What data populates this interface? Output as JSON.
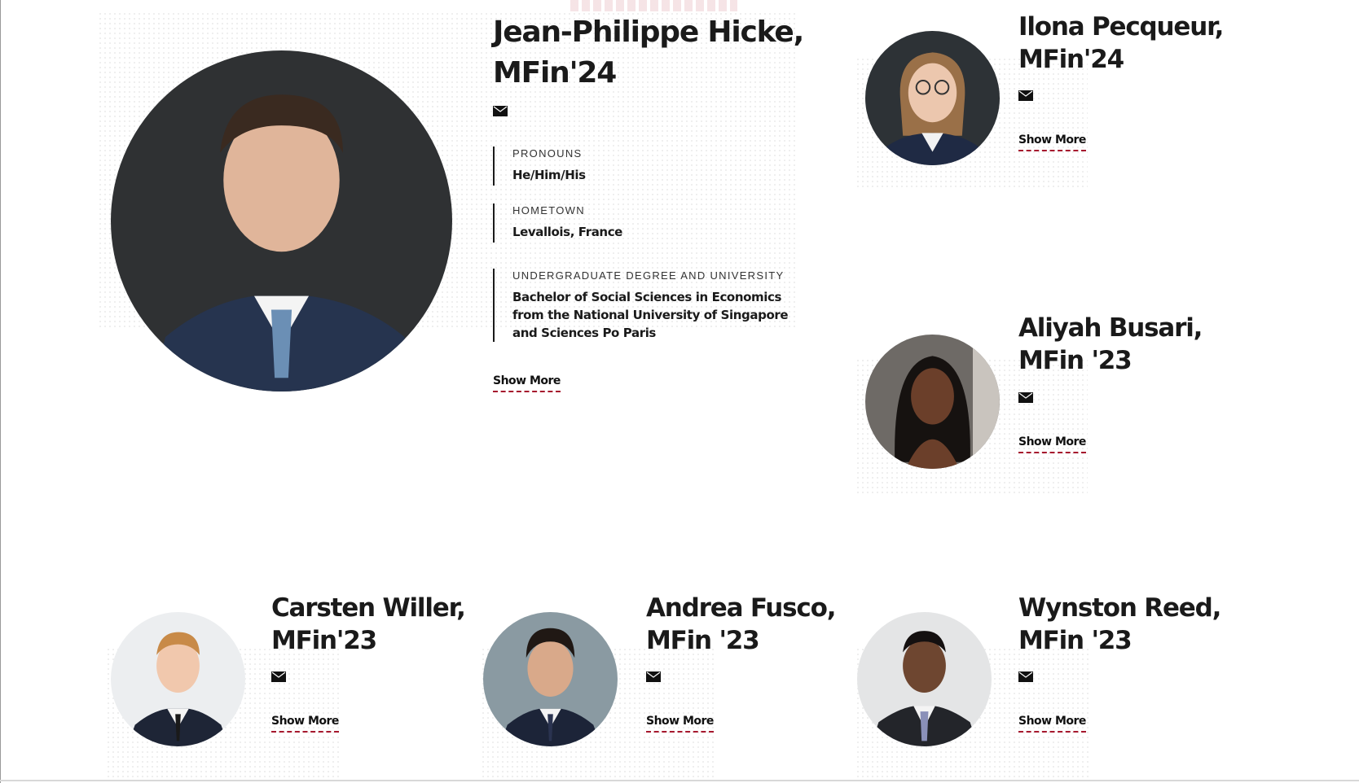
{
  "featured": {
    "name_line1": "Jean-Philippe Hicke,",
    "name_line2": "MFin'24",
    "email_icon": "envelope-icon",
    "facts": [
      {
        "label": "PRONOUNS",
        "value": "He/Him/His"
      },
      {
        "label": "HOMETOWN",
        "value": "Levallois, France"
      },
      {
        "label": "UNDERGRADUATE DEGREE AND UNIVERSITY",
        "value": "Bachelor of Social Sciences in Economics from the National University of Singapore and Sciences Po Paris"
      }
    ],
    "show_more": "Show More"
  },
  "profiles": [
    {
      "name_line1": "Ilona Pecqueur,",
      "name_line2": "MFin'24",
      "show_more": "Show More"
    },
    {
      "name_line1": "Aliyah Busari,",
      "name_line2": "MFin '23",
      "show_more": "Show More"
    },
    {
      "name_line1": "Carsten Willer,",
      "name_line2": "MFin'23",
      "show_more": "Show More"
    },
    {
      "name_line1": "Andrea Fusco,",
      "name_line2": "MFin '23",
      "show_more": "Show More"
    },
    {
      "name_line1": "Wynston Reed,",
      "name_line2": "MFin '23",
      "show_more": "Show More"
    }
  ],
  "colors": {
    "accent": "#a6192e",
    "text": "#1a1a1a"
  }
}
